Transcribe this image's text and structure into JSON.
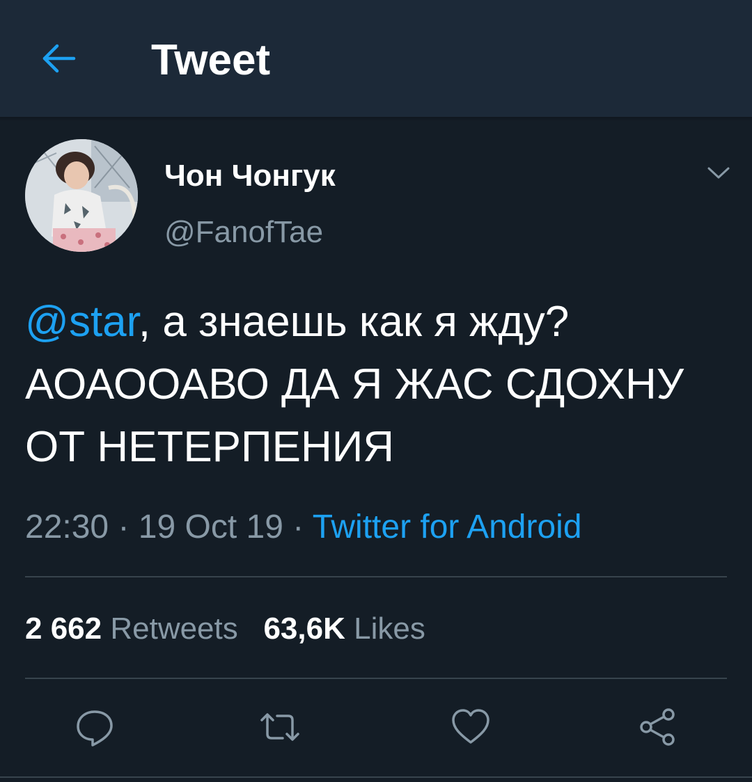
{
  "header": {
    "title": "Tweet",
    "back_icon": "arrow-left-icon"
  },
  "author": {
    "display_name": "Чон Чонгук",
    "handle": "@FanofTae",
    "avatar": "avatar-photo"
  },
  "tweet": {
    "mention": "@star",
    "text_after_mention": ", а знаешь как я жду? АОАООАВО ДА Я ЖАС СДОХНУ ОТ НЕТЕРПЕНИЯ",
    "time": "22:30",
    "date": "19 Oct 19",
    "separator": " · ",
    "source": "Twitter for Android"
  },
  "stats": {
    "retweets_count": "2 662",
    "retweets_label": "Retweets",
    "likes_count": "63,6K",
    "likes_label": "Likes"
  },
  "actions": [
    "reply-icon",
    "retweet-icon",
    "like-icon",
    "share-icon"
  ],
  "colors": {
    "background": "#141d26",
    "header_bg": "#1c2938",
    "accent": "#1da1f2",
    "secondary_text": "#8899a6",
    "divider": "#38444d"
  }
}
